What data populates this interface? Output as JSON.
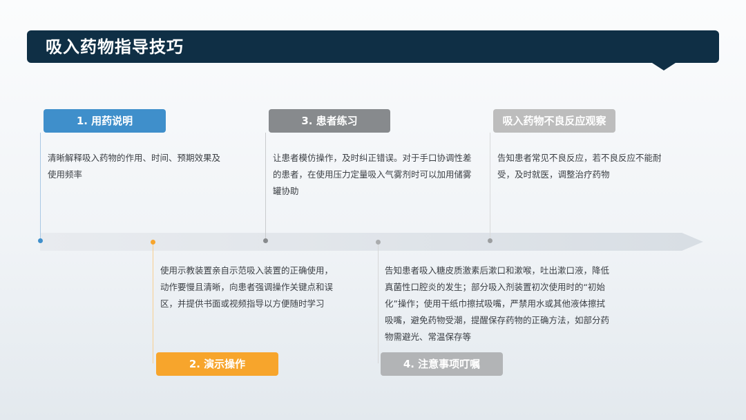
{
  "header": {
    "title": "吸入药物指导技巧"
  },
  "steps": [
    {
      "label": "1. 用药说明",
      "text": "清晰解释吸入药物的作用、时间、预期效果及使用频率",
      "color": "#3f8fcb"
    },
    {
      "label": "2. 演示操作",
      "text": "使用示教装置亲自示范吸入装置的正确使用，动作要慢且清晰，向患者强调操作关键点和误区，并提供书面或视频指导以方便随时学习",
      "color": "#f7a52c"
    },
    {
      "label": "3. 患者练习",
      "text": "让患者模仿操作，及时纠正错误。对于手口协调性差的患者，在使用压力定量吸入气雾剂时可以加用储雾罐协助",
      "color": "#878a8d"
    },
    {
      "label": "4. 注意事项叮嘱",
      "text": "告知患者吸入糖皮质激素后漱口和漱喉，吐出漱口液，降低真菌性口腔炎的发生；部分吸入剂装置初次使用时的“初始化”操作；使用干纸巾擦拭吸嘴，严禁用水或其他液体擦拭吸嘴，避免药物受潮，提醒保存药物的正确方法，如部分药物需避光、常温保存等",
      "color": "#b2b4b6"
    },
    {
      "label": "吸入药物不良反应观察",
      "text": "告知患者常见不良反应，若不良反应不能耐受，及时就医，调整治疗药物",
      "color": "#bdbdbd"
    }
  ]
}
